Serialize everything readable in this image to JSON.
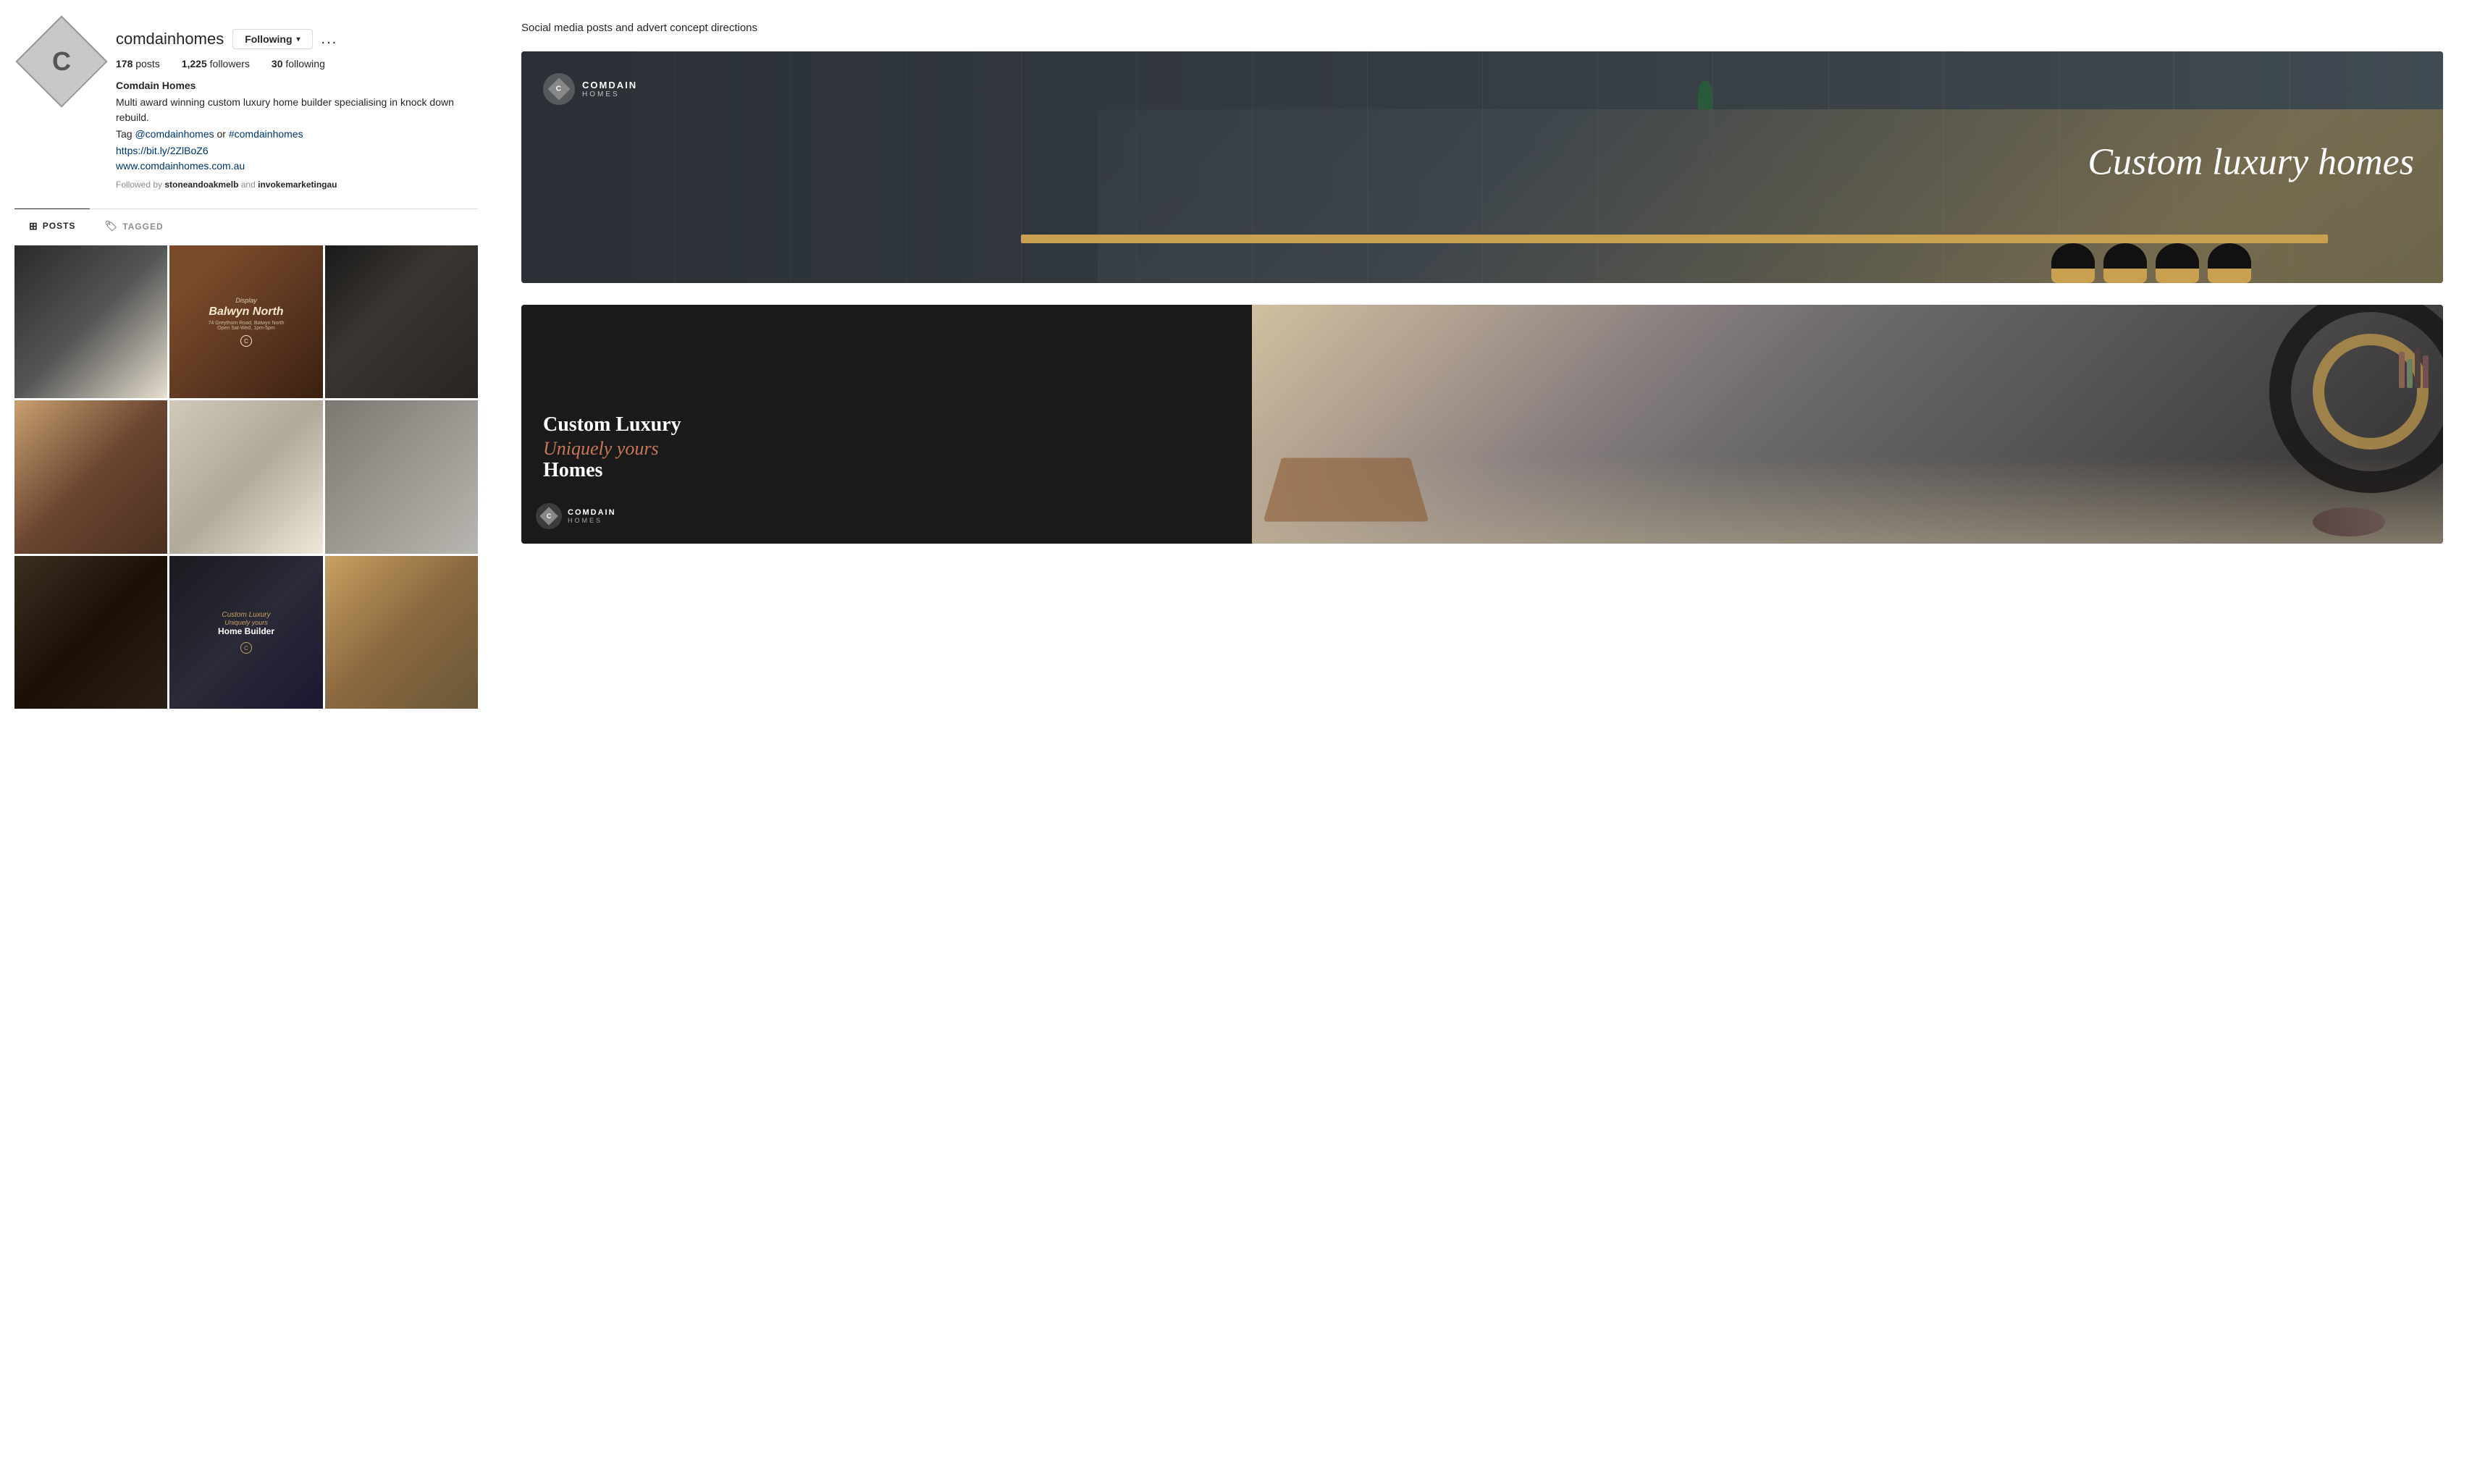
{
  "left": {
    "username": "comdainhomes",
    "follow_btn": "Following",
    "more_btn": "...",
    "stats": {
      "posts_count": "178",
      "posts_label": "posts",
      "followers_count": "1,225",
      "followers_label": "followers",
      "following_count": "30",
      "following_label": "following"
    },
    "bio": {
      "name": "Comdain Homes",
      "line1": "Multi award winning custom luxury home builder specialising in knock down rebuild.",
      "line2": "Tag @comdainhomes or #comdainhomes",
      "link_url": "https://bit.ly/2ZlBoZ6",
      "link_label": "https://bit.ly/2ZlBoZ6",
      "website": "www.comdainhomes.com.au",
      "followed_by": "Followed by stoneandoakmelb and invokemarketingau"
    },
    "tabs": {
      "posts": "POSTS",
      "tagged": "TAGGED"
    },
    "grid": {
      "cells": [
        {
          "id": 1,
          "type": "bathroom"
        },
        {
          "id": 2,
          "type": "balwyn",
          "overlay_display": "Display",
          "overlay_title": "Balwyn North",
          "overlay_sub": "74 Greythorn Road, Balwyn North\nOpen Sat-Wed, 1pm-5pm"
        },
        {
          "id": 3,
          "type": "marble"
        },
        {
          "id": 4,
          "type": "hallway"
        },
        {
          "id": 5,
          "type": "hands"
        },
        {
          "id": 6,
          "type": "bathroom2"
        },
        {
          "id": 7,
          "type": "textures"
        },
        {
          "id": 8,
          "type": "luxury",
          "overlay_cursive": "Custom Luxury",
          "overlay_title": "Home Builder"
        },
        {
          "id": 9,
          "type": "bathroom3"
        }
      ]
    }
  },
  "right": {
    "section_title": "Social media posts and advert concept directions",
    "ad1": {
      "logo_letter": "C",
      "logo_name": "COMDAIN",
      "logo_sub": "HOMES",
      "headline": "Custom luxury homes"
    },
    "ad2": {
      "headline_line1": "Custom Luxury",
      "headline_cursive": "Uniquely yours",
      "headline_line2": "Homes",
      "logo_letter": "C",
      "logo_name": "COMDAIN",
      "logo_sub": "HOMES"
    }
  }
}
